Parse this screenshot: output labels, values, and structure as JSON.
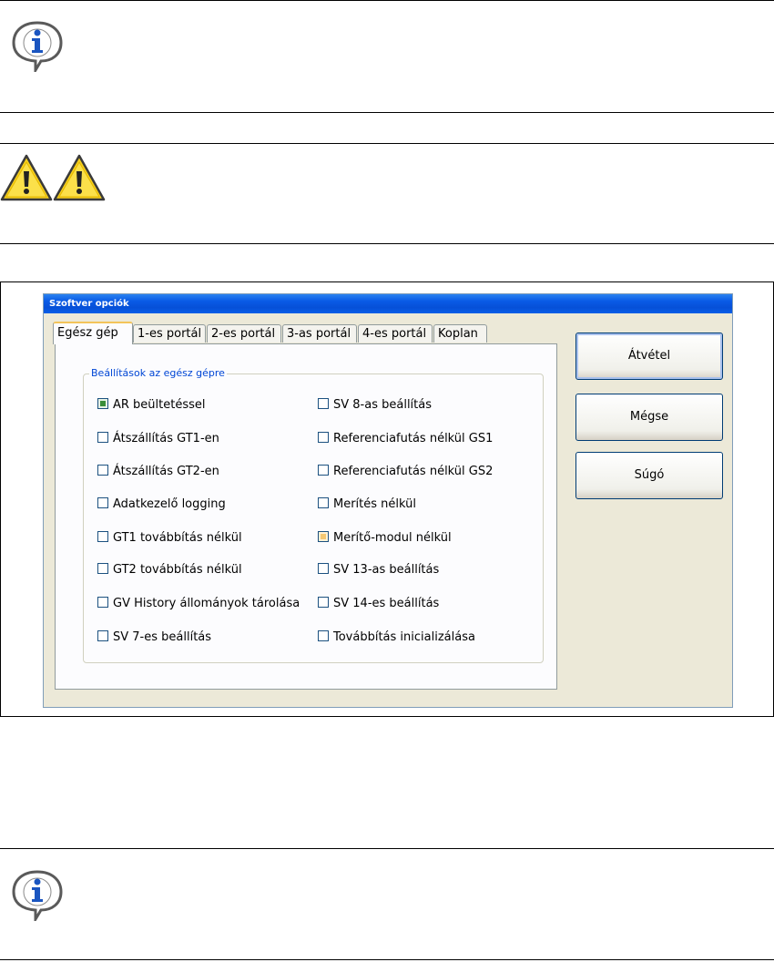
{
  "dialog": {
    "title": "Szoftver opciók",
    "tabs": [
      {
        "label": "Egész gép",
        "active": true
      },
      {
        "label": "1-es portál",
        "active": false
      },
      {
        "label": "2-es portál",
        "active": false
      },
      {
        "label": "3-as portál",
        "active": false
      },
      {
        "label": "4-es portál",
        "active": false
      },
      {
        "label": "Koplan",
        "active": false
      }
    ],
    "group_title": "Beállítások az egész gépre",
    "options_left": [
      {
        "label": "AR beültetéssel",
        "checked": true
      },
      {
        "label": "Átszállítás GT1-en",
        "checked": false
      },
      {
        "label": "Átszállítás GT2-en",
        "checked": false
      },
      {
        "label": "Adatkezelő logging",
        "checked": false
      },
      {
        "label": "GT1 továbbítás nélkül",
        "checked": false
      },
      {
        "label": "GT2 továbbítás nélkül",
        "checked": false
      },
      {
        "label": "GV History állományok tárolása",
        "checked": false
      },
      {
        "label": "SV 7-es beállítás",
        "checked": false
      }
    ],
    "options_right": [
      {
        "label": "SV 8-as beállítás",
        "checked": false
      },
      {
        "label": "Referenciafutás nélkül GS1",
        "checked": false
      },
      {
        "label": "Referenciafutás nélkül GS2",
        "checked": false
      },
      {
        "label": "Merítés nélkül",
        "checked": false
      },
      {
        "label": "Merítő-modul nélkül",
        "checked": false,
        "highlighted": true
      },
      {
        "label": "SV 13-as beállítás",
        "checked": false
      },
      {
        "label": "SV 14-es beállítás",
        "checked": false
      },
      {
        "label": "Továbbítás inicializálása",
        "checked": false
      }
    ],
    "buttons": {
      "apply": "Átvétel",
      "cancel": "Mégse",
      "help": "Súgó"
    }
  },
  "icons": [
    "info-icon",
    "warning-icon",
    "warning-icon",
    "info-icon"
  ],
  "colors": {
    "titlebar": "#0a5be6",
    "dialog_bg": "#ECE9D8",
    "group_title": "#0046d5",
    "checkbox_checked": "#3a8e3a",
    "checkbox_highlight": "#f5c872"
  }
}
